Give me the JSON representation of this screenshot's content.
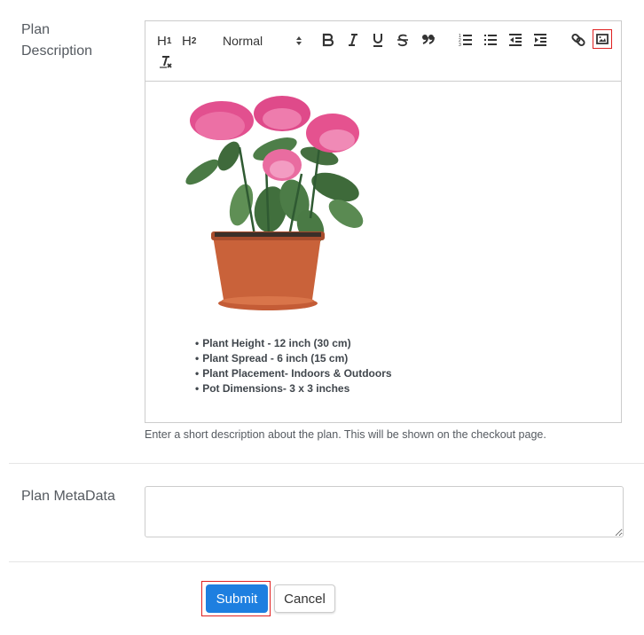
{
  "form": {
    "description_label": "Plan Description",
    "description_help": "Enter a short description about the plan. This will be shown on the checkout page.",
    "metadata_label": "Plan MetaData",
    "metadata_value": ""
  },
  "toolbar": {
    "h1": "H",
    "h1_sub": "1",
    "h2": "H",
    "h2_sub": "2",
    "format_select": "Normal",
    "icons": [
      "bold-icon",
      "italic-icon",
      "underline-icon",
      "strike-icon",
      "blockquote-icon",
      "ordered-list-icon",
      "bullet-list-icon",
      "outdent-icon",
      "indent-icon",
      "link-icon",
      "image-icon",
      "clear-format-icon"
    ],
    "highlighted": "image-icon",
    "highlight_color": "#e02020"
  },
  "editor": {
    "image_alt": "pink hydrangea in terracotta pot",
    "bullets": [
      "Plant Height - 12 inch (30 cm)",
      "Plant Spread - 6 inch (15 cm)",
      "Plant Placement- Indoors & Outdoors",
      "Pot Dimensions- 3 x 3 inches"
    ]
  },
  "actions": {
    "submit": "Submit",
    "cancel": "Cancel",
    "submit_color": "#1e7fe0"
  }
}
